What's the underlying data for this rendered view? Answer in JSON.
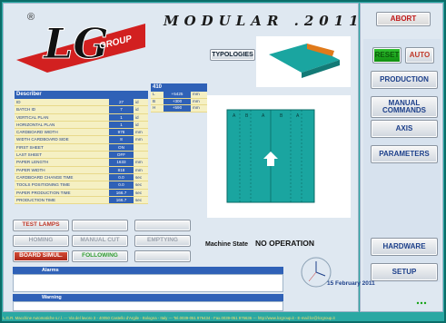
{
  "header": {
    "title": "MODULAR .2011",
    "abort_label": "ABORT",
    "logo_letters": "LG",
    "logo_word": "GROUP",
    "logo_mark": "®"
  },
  "colors": {
    "accent": "#2f61b7",
    "frame": "#2aa8a3",
    "reset_green": "#18a418",
    "abort_red": "#c01818",
    "board_simul_red": "#c03828",
    "following_green": "#2e9c2e"
  },
  "right_menu": {
    "reset_label": "RESET",
    "auto_label": "AUTO",
    "items": [
      {
        "label": "PRODUCTION"
      },
      {
        "label": "MANUAL\nCOMMANDS"
      },
      {
        "label": "AXIS"
      },
      {
        "label": "PARAMETERS"
      }
    ],
    "hardware_label": "HARDWARE",
    "setup_label": "SETUP"
  },
  "typologies_label": "TYPOLOGIES",
  "describer": {
    "heading": "Describer",
    "rows": [
      {
        "k": "ID",
        "v": "27",
        "u": "id"
      },
      {
        "k": "BATCH ID",
        "v": "7",
        "u": "id"
      },
      {
        "k": "VERTICAL PLAN",
        "v": "1",
        "u": "id"
      },
      {
        "k": "HORIZONTAL PLAN",
        "v": "1",
        "u": "id"
      },
      {
        "k": "CARDBOARD WIDTH",
        "v": "978",
        "u": "mm"
      },
      {
        "k": "WIDTH CARDBOARD SIDE",
        "v": "8",
        "u": "mm"
      },
      {
        "k": "FIRST SHEET",
        "v": "ON",
        "u": ""
      },
      {
        "k": "LAST SHEET",
        "v": "OFF",
        "u": ""
      },
      {
        "k": "PAPER LENGTH",
        "v": "1633",
        "u": "mm"
      },
      {
        "k": "PAPER WIDTH",
        "v": "818",
        "u": "mm"
      },
      {
        "k": "CARDBOARD CHANGE TIME",
        "v": "0.0",
        "u": "sec"
      },
      {
        "k": "TOOLS POSITIONING TIME",
        "v": "0.0",
        "u": "sec"
      },
      {
        "k": "PAPER PRODUCTION TIME",
        "v": "166.7",
        "u": "sec"
      },
      {
        "k": "PRODUCTION TIME",
        "v": "166.7",
        "u": "sec"
      }
    ]
  },
  "coords": {
    "heading": "410",
    "rows": [
      {
        "k": "L",
        "v": "+5425",
        "u": "mm"
      },
      {
        "k": "B",
        "v": "+300",
        "u": "mm"
      },
      {
        "k": "H",
        "v": "+590",
        "u": "mm"
      }
    ]
  },
  "drawing": {
    "letters": [
      "A",
      "B",
      "A",
      "B",
      "A"
    ]
  },
  "operations": {
    "test_lamps": "TEST LAMPS",
    "homing": "HOMING",
    "manual_cut": "MANUAL CUT",
    "emptying": "EMPTYING",
    "board_simul": "BOARD SIMUL.",
    "following": "FOLLOWING"
  },
  "machine_state": {
    "label": "Machine State",
    "value": "NO OPERATION"
  },
  "alarms": {
    "title": "Alarms"
  },
  "warning": {
    "title": "Warning"
  },
  "date": "15 February 2011",
  "footer": "L.G.R. Macchine Automatiche s.r.l.  ---  Via del lavoro 3 - 40050 Castello d'Argile - Bologna - Italy  ---  Tel.0039-051 976434 - Fax.0039-051 976636  ---  http://www.lcrgroup.it - E-mail:lcr@lcrgroup.it"
}
